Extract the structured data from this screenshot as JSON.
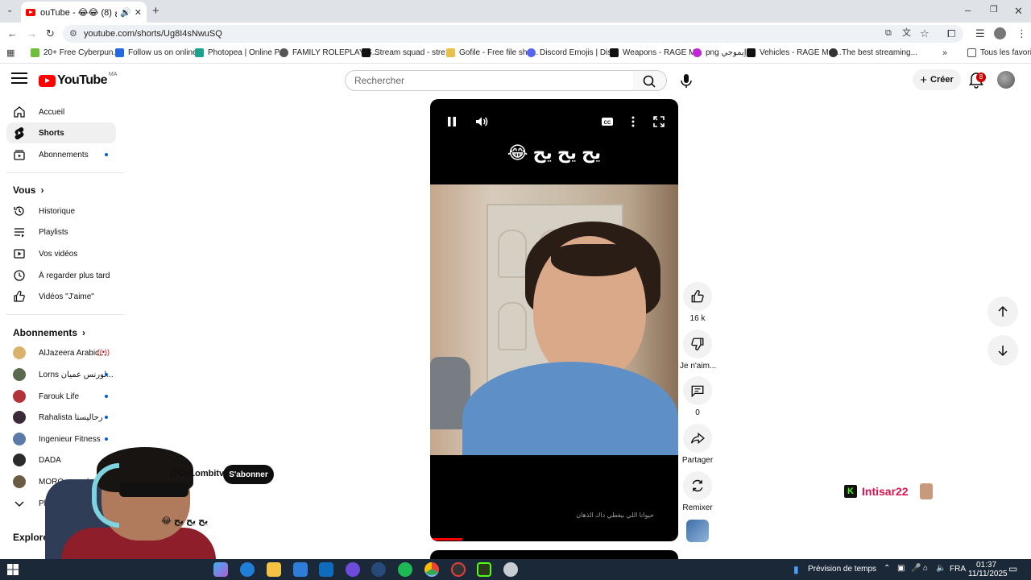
{
  "browser": {
    "tab_title": "ouTube - 😂😂 يح يح يح (8)",
    "url": "youtube.com/shorts/Ug8I4sNwuSQ",
    "bookmarks": [
      "20+ Free Cyberpun...",
      "Follow us on online...",
      "Photopea | Online P...",
      "FAMILY ROLEPLAY S...",
      "Stream squad - stre...",
      "Gofile - Free file sha...",
      "Discord Emojis | Dis...",
      "Weapons - RAGE M...",
      "png إيموجي",
      "Vehicles - RAGE Mul...",
      "The best streaming..."
    ],
    "all_bookmarks": "Tous les favoris"
  },
  "header": {
    "logo": "YouTube",
    "country": "MA",
    "search_placeholder": "Rechercher",
    "create_label": "Créer",
    "notif_count": "8"
  },
  "sidebar": {
    "main": [
      {
        "label": "Accueil",
        "icon": "home-icon"
      },
      {
        "label": "Shorts",
        "icon": "shorts-icon"
      },
      {
        "label": "Abonnements",
        "icon": "subscriptions-icon"
      }
    ],
    "you_heading": "Vous",
    "you": [
      {
        "label": "Historique",
        "icon": "history-icon"
      },
      {
        "label": "Playlists",
        "icon": "playlist-icon"
      },
      {
        "label": "Vos vidéos",
        "icon": "your-videos-icon"
      },
      {
        "label": "À regarder plus tard",
        "icon": "watch-later-icon"
      },
      {
        "label": "Vidéos \"J'aime\"",
        "icon": "liked-icon"
      }
    ],
    "subs_heading": "Abonnements",
    "subs": [
      {
        "label": "AlJazeera Arabic...",
        "color": "#d9b36c"
      },
      {
        "label": "Lorns لورنس عميان...",
        "color": "#5a6b4d"
      },
      {
        "label": "Farouk Life",
        "color": "#b2343a"
      },
      {
        "label": "Rahalista رحاليستا",
        "color": "#3a2a3a"
      },
      {
        "label": "Ingenieur Fitness",
        "color": "#5c7aa8"
      },
      {
        "label": "DADA",
        "color": "#2b2b2b"
      },
      {
        "label": "MORO موروو/",
        "color": "#6b5b44"
      }
    ],
    "more_label": "Plus",
    "explore_heading": "Explorer"
  },
  "player": {
    "caption": "يح يح يح 😂",
    "subtitle": "حيوانا اللي بيغطي داك الذهان"
  },
  "actions": {
    "likes": "16 k",
    "dislike": "Je n'aim...",
    "comments": "0",
    "share": "Partager",
    "remix": "Remixer"
  },
  "overlay": {
    "channel": "@CoLombitv",
    "subscribe": "S'abonner",
    "desc": "يح يح يح 😂",
    "streamer": "Intisar22"
  },
  "taskbar": {
    "weather": "Prévision de temps",
    "lang": "FRA",
    "time": "01:37",
    "date": "11/11/2025"
  },
  "colors": {
    "yt_red": "#ff0000",
    "accent_blue": "#065fd4",
    "taskbar": "#1b2838"
  }
}
